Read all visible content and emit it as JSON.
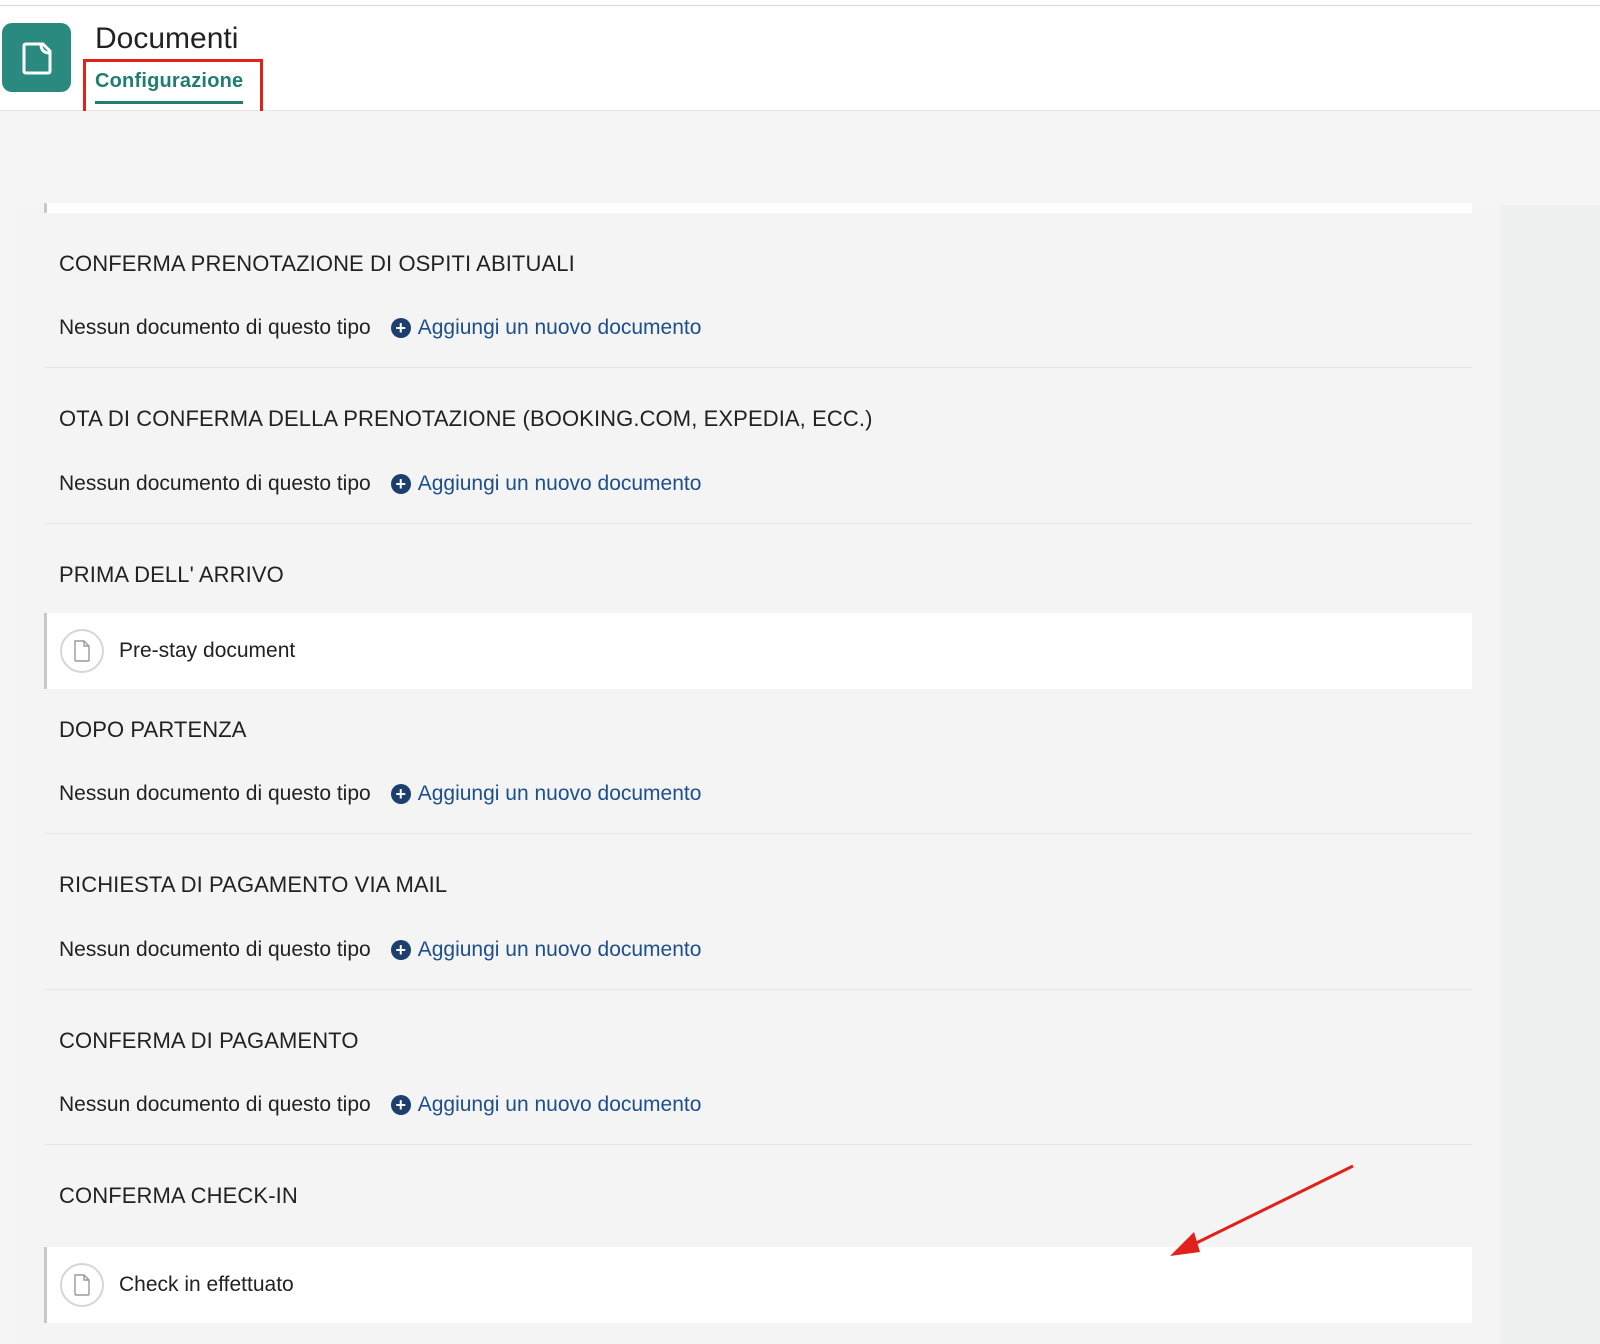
{
  "app": {
    "title": "Documenti",
    "icon": "document-page-icon",
    "accent_color": "#2a8a80"
  },
  "tabs": [
    {
      "label": "Configurazione",
      "active": true
    }
  ],
  "annotations": {
    "highlight_color": "#e0221a",
    "highlight_target": "tab-configurazione",
    "arrow_target": "document-check-in-effettuato"
  },
  "sections": [
    {
      "title": "CONFERMA PRENOTAZIONE DI OSPITI ABITUALI",
      "empty_text": "Nessun documento di questo tipo",
      "add_label": "Aggiungi un nuovo documento"
    },
    {
      "title": "OTA DI CONFERMA DELLA PRENOTAZIONE (BOOKING.COM, EXPEDIA, ECC.)",
      "empty_text": "Nessun documento di questo tipo",
      "add_label": "Aggiungi un nuovo documento"
    },
    {
      "title": "PRIMA DELL' ARRIVO",
      "document": "Pre-stay document"
    },
    {
      "title": "DOPO PARTENZA",
      "empty_text": "Nessun documento di questo tipo",
      "add_label": "Aggiungi un nuovo documento"
    },
    {
      "title": "RICHIESTA DI PAGAMENTO VIA MAIL",
      "empty_text": "Nessun documento di questo tipo",
      "add_label": "Aggiungi un nuovo documento"
    },
    {
      "title": "CONFERMA DI PAGAMENTO",
      "empty_text": "Nessun documento di questo tipo",
      "add_label": "Aggiungi un nuovo documento"
    },
    {
      "title": "CONFERMA CHECK-IN",
      "document": "Check in effettuato"
    }
  ]
}
